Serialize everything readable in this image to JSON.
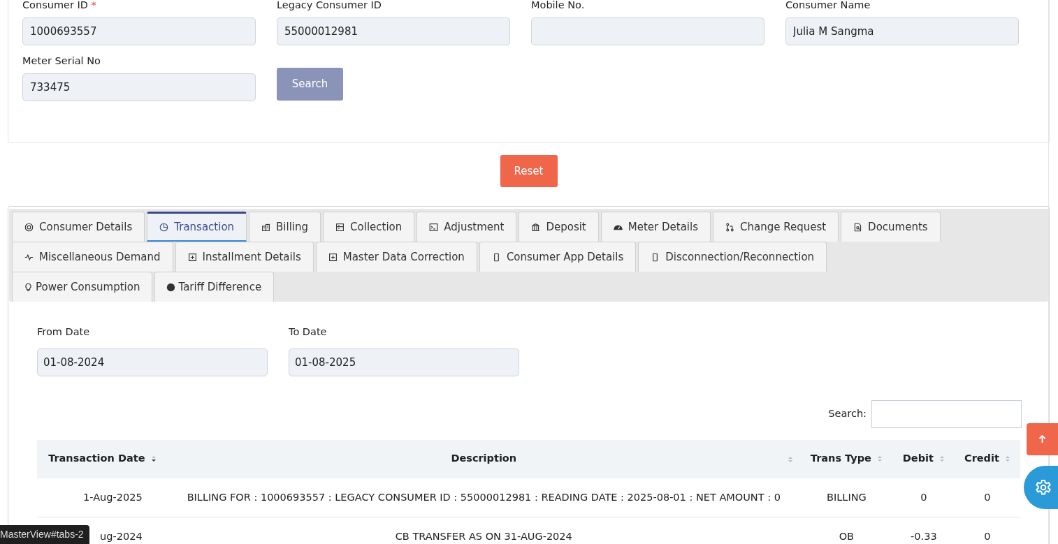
{
  "consumer_form": {
    "fields": [
      {
        "label": "Consumer ID",
        "required_mark": "*",
        "value": "1000693557"
      },
      {
        "label": "Legacy Consumer ID",
        "value": "55000012981"
      },
      {
        "label": "Mobile No."
      },
      {
        "label": "Consumer Name",
        "value": "Julia M Sangma"
      },
      {
        "label": "Meter Serial No",
        "value": "733475"
      }
    ],
    "search_button": "Search"
  },
  "reset_button": "Reset",
  "tab_rows": [
    [
      {
        "label": "Consumer Details",
        "selected": false
      },
      {
        "label": "Transaction",
        "selected": true
      },
      {
        "label": "Billing",
        "selected": false
      },
      {
        "label": "Collection",
        "selected": false
      },
      {
        "label": "Adjustment",
        "selected": false
      },
      {
        "label": "Deposit",
        "selected": false
      },
      {
        "label": "Meter Details",
        "selected": false
      },
      {
        "label": "Change Request",
        "selected": false
      },
      {
        "label": "Documents",
        "selected": false
      }
    ],
    [
      {
        "label": "Miscellaneous Demand",
        "selected": false
      },
      {
        "label": "Installment Details",
        "selected": false
      },
      {
        "label": "Master Data Correction",
        "selected": false
      },
      {
        "label": "Consumer App Details",
        "selected": false
      },
      {
        "label": "Disconnection/Reconnection",
        "selected": false
      }
    ],
    [
      {
        "label": "Power Consumption",
        "selected": false
      },
      {
        "label": "Tariff Difference",
        "selected": false
      }
    ]
  ],
  "date_filter": {
    "from": {
      "label": "From Date",
      "value": "01-08-2024"
    },
    "to": {
      "label": "To Date",
      "value": "01-08-2025"
    }
  },
  "table": {
    "search_label": "Search:",
    "columns": [
      {
        "label": "Transaction Date",
        "sorted": true
      },
      {
        "label": "Description",
        "sorted": false
      },
      {
        "label": "Trans Type",
        "sorted": false
      },
      {
        "label": "Debit",
        "sorted": false
      },
      {
        "label": "Credit",
        "sorted": false
      }
    ],
    "rows": [
      [
        "1-Aug-2025",
        "BILLING FOR : 1000693557 : LEGACY CONSUMER ID : 55000012981 : READING DATE : 2025-08-01 : NET AMOUNT : 0",
        "BILLING",
        "0",
        "0"
      ],
      [
        "ug-2024",
        "CB TRANSFER AS ON 31-AUG-2024",
        "OB",
        "-0.33",
        "0"
      ]
    ]
  },
  "status_bar": "MasterView#tabs-2"
}
